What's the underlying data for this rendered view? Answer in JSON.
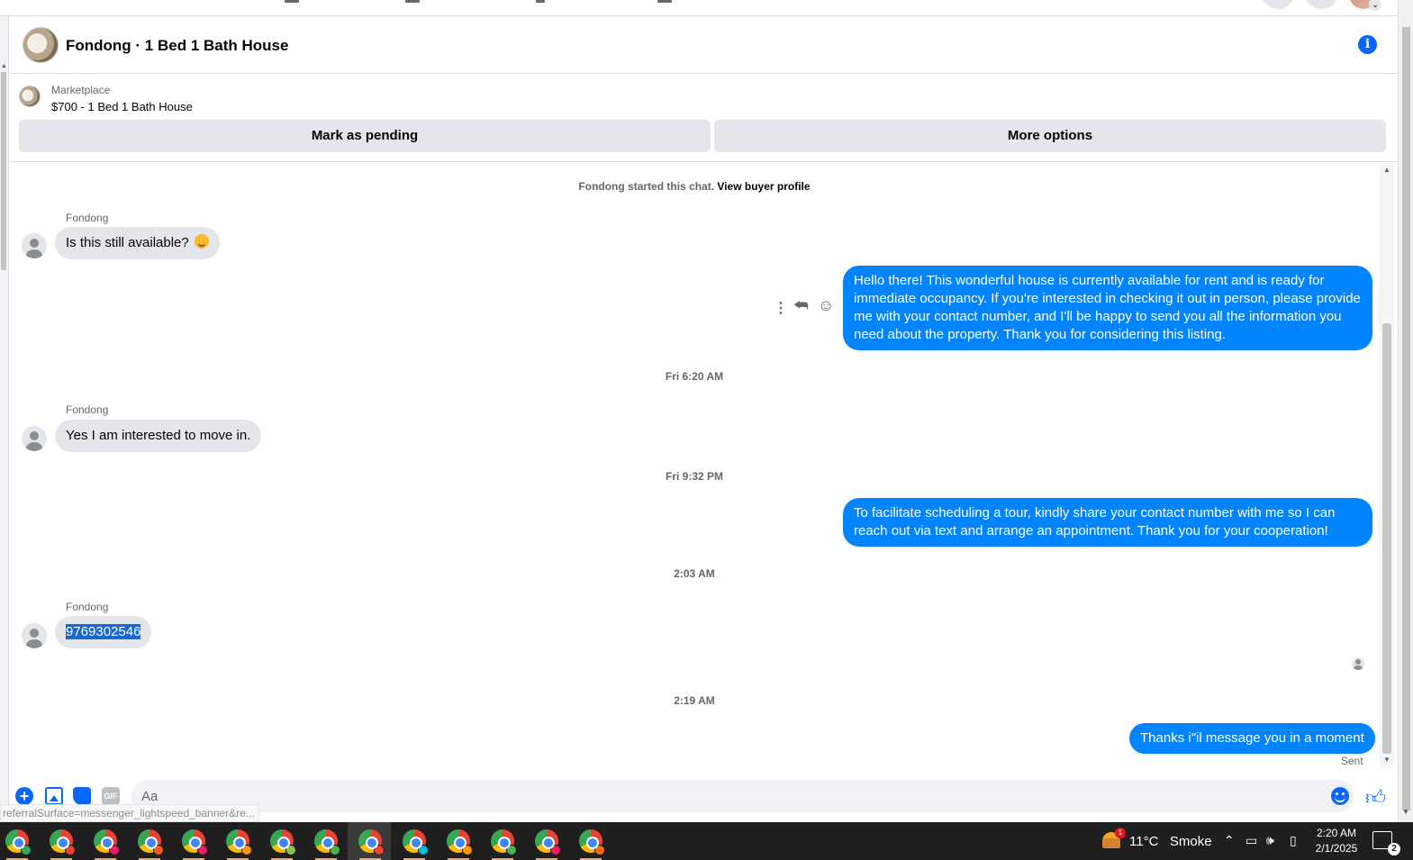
{
  "header": {
    "title": "Fondong · 1 Bed 1 Bath House"
  },
  "listing": {
    "source": "Marketplace",
    "price_title": "$700 - 1 Bed 1 Bath House",
    "mark_pending_label": "Mark as pending",
    "more_options_label": "More options"
  },
  "chat": {
    "started_text": "Fondong started this chat.",
    "view_profile_label": "View buyer profile",
    "messages": [
      {
        "sender": "Fondong",
        "text": "Is this still available?",
        "direction": "incoming"
      },
      {
        "text": "Hello there! This wonderful house is currently available for rent and is ready for immediate occupancy. If you're interested in checking it out in person, please provide me with your contact number, and I'll be happy to send you all the information you need about the property. Thank you for considering this listing.",
        "direction": "outgoing"
      },
      {
        "timestamp": "Fri 6:20 AM"
      },
      {
        "sender": "Fondong",
        "text": "Yes I am interested to move in.",
        "direction": "incoming"
      },
      {
        "timestamp": "Fri 9:32 PM"
      },
      {
        "text": "To facilitate scheduling a tour, kindly share your contact number with me so I can reach out via text and arrange an appointment. Thank you for your cooperation!",
        "direction": "outgoing"
      },
      {
        "timestamp": "2:03 AM"
      },
      {
        "sender": "Fondong",
        "text": "9769302546",
        "direction": "incoming",
        "selected": true
      },
      {
        "timestamp": "2:19 AM"
      },
      {
        "text": "Thanks i\"il message you in a moment",
        "direction": "outgoing"
      }
    ],
    "status": "Sent"
  },
  "composer": {
    "placeholder": "Aa",
    "gif_label": "GIF"
  },
  "status_url": "referralSurface=messenger_lightspeed_banner&re...",
  "taskbar": {
    "weather_temp": "11°C",
    "weather_text": "Smoke",
    "weather_badge": "1",
    "time": "2:20 AM",
    "date": "2/1/2025",
    "notification_count": "2",
    "app_overlay_colors": [
      "#34a853",
      "#ea4335",
      "#e91e63",
      "#ff5722",
      "#e91e63",
      "#ff9800",
      "#8bc34a",
      "#4caf50",
      "#f44336",
      "#00bcd4",
      "#ff9800",
      "#4caf50",
      "#e91e63",
      "#ff6f00"
    ]
  },
  "colors": {
    "accent": "#0866ff",
    "outgoing_bubble": "#0084ff",
    "incoming_bubble": "#e4e6eb",
    "taskbar": "#1f1f1f"
  }
}
